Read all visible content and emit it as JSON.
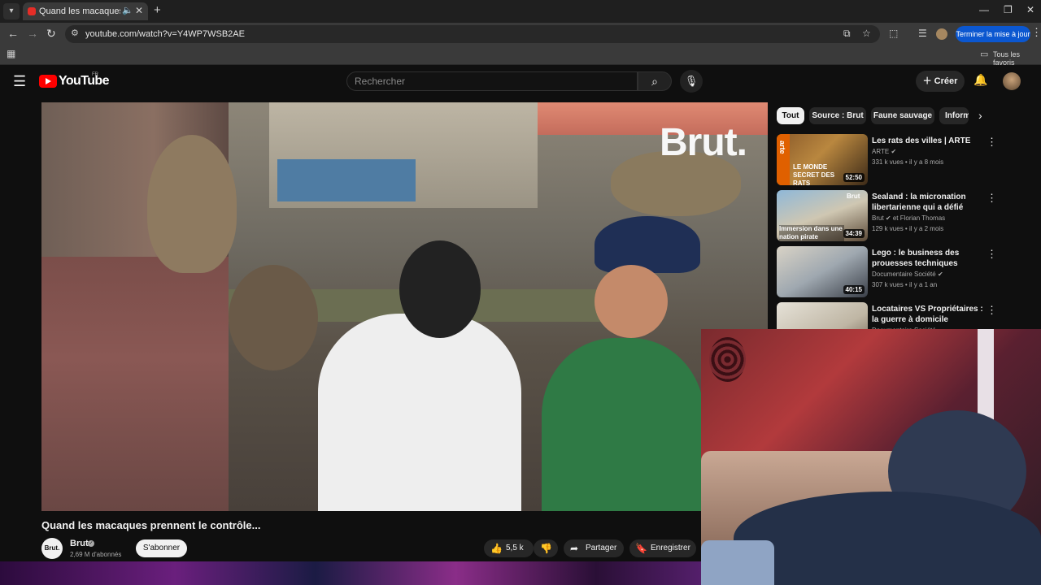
{
  "browser": {
    "tab_title": "Quand les macaques prennent",
    "url": "youtube.com/watch?v=Y4WP7WSB2AE",
    "update_label": "Terminer la mise à jour",
    "bookmarks_label": "Tous les favoris"
  },
  "youtube": {
    "logo_text": "YouTube",
    "country": "FR",
    "search_placeholder": "Rechercher",
    "create_label": "Créer"
  },
  "video": {
    "watermark": "Brut.",
    "title": "Quand les macaques prennent le contrôle...",
    "channel": {
      "avatar_text": "Brut.",
      "name": "Brut",
      "subscribers": "2,69 M d'abonnés",
      "subscribe_label": "S'abonner"
    },
    "actions": {
      "likes": "5,5 k",
      "share_label": "Partager",
      "save_label": "Enregistrer"
    }
  },
  "chips": [
    "Tout",
    "Source : Brut",
    "Faune sauvage",
    "Inform"
  ],
  "recommendations": [
    {
      "title": "Les rats des villes | ARTE",
      "channel": "ARTE",
      "meta": "331 k vues • il y a 8 mois",
      "duration": "52:50",
      "thumb_text": "LE MONDE SECRET DES RATS",
      "thumb_brand": "arte"
    },
    {
      "title": "Sealand : la micronation libertarienne qui a défié l'armé...",
      "channel": "Brut",
      "channel_extra": "et Florian Thomas",
      "meta": "129 k vues • il y a 2 mois",
      "duration": "34:39",
      "thumb_text": "Immersion dans une nation pirate",
      "thumb_brand": "Brut"
    },
    {
      "title": "Lego : le business des prouesses techniques",
      "channel": "Documentaire Société",
      "meta": "307 k vues • il y a 1 an",
      "duration": "40:15"
    },
    {
      "title": "Locataires VS Propriétaires : la guerre à domicile",
      "channel": "Documentaire Société"
    }
  ],
  "colors": {
    "yt_red": "#ff0000",
    "bg": "#0f0f0f",
    "chip_active": "#f1f1f1",
    "update_blue": "#0b57d0"
  },
  "icons": {
    "hamburger": "menu-icon",
    "search": "search-icon",
    "mic": "mic-icon",
    "bell": "bell-icon",
    "like": "thumbs-up-icon",
    "dislike": "thumbs-down-icon",
    "share": "share-icon",
    "save": "bookmark-icon"
  }
}
